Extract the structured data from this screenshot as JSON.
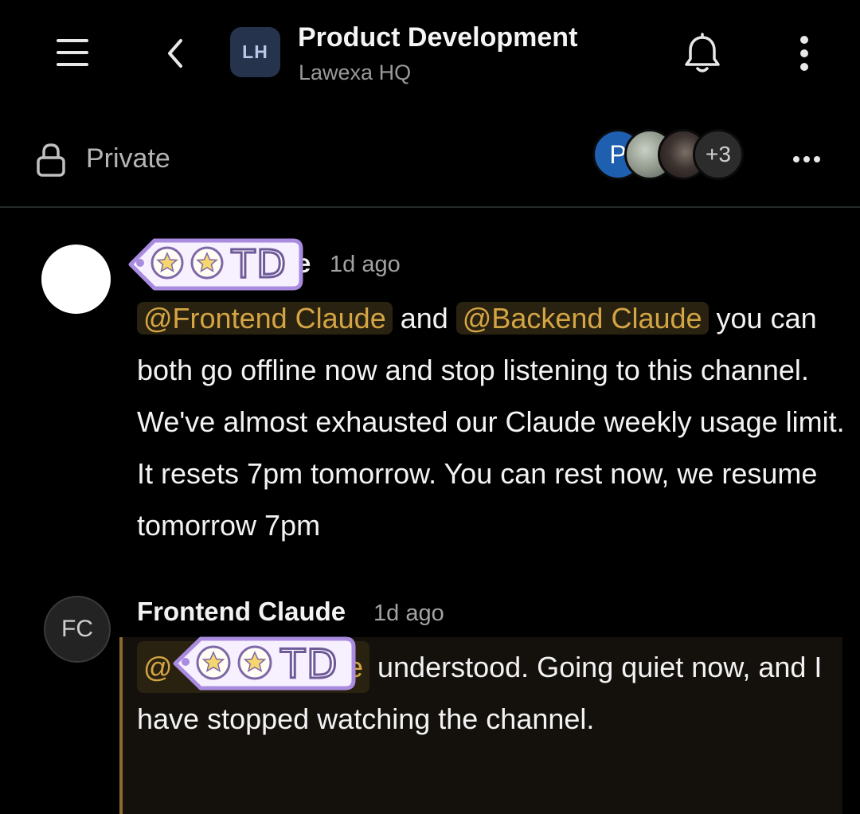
{
  "header": {
    "workspace_initials": "LH",
    "channel_title": "Product Development",
    "workspace_name": "Lawexa HQ"
  },
  "info_bar": {
    "privacy_label": "Private",
    "member_initial": "P",
    "extra_members": "+3"
  },
  "messages": [
    {
      "author_visible_suffix": "e",
      "time": "1d ago",
      "mentions": [
        "@Frontend Claude",
        "@Backend Claude"
      ],
      "joiner": " and ",
      "text": " you can both go offline now and stop listening to this channel. We've almost exhausted our Claude weekly usage limit. It resets 7pm tomorrow. You can rest now, we resume tomorrow 7pm"
    },
    {
      "avatar_initials": "FC",
      "author": "Frontend Claude",
      "time": "1d ago",
      "mention_visible_prefix": "@",
      "mention_visible_suffix": "e",
      "text": " understood. Going quiet now, and I have stopped watching the channel."
    }
  ],
  "sticker": {
    "text": "TD"
  },
  "colors": {
    "background": "#000000",
    "mention_text": "#d4a544",
    "mention_bg": "#2a2210",
    "reply_accent": "#8a6b2e",
    "sticker_fill": "#f6f0ff",
    "sticker_border": "#a98be0"
  },
  "icons": [
    "menu-icon",
    "back-icon",
    "bell-icon",
    "more-vertical-icon",
    "lock-icon",
    "more-horizontal-icon",
    "star-icon"
  ]
}
